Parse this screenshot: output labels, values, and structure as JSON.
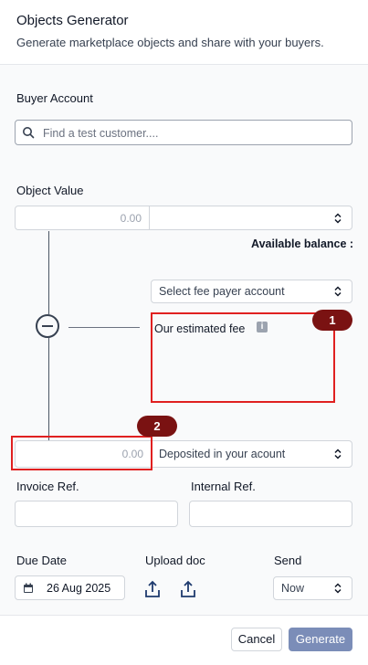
{
  "header": {
    "title": "Objects Generator",
    "subtitle": "Generate marketplace objects and share with your buyers."
  },
  "buyer_account": {
    "label": "Buyer Account",
    "search_placeholder": "Find a test customer...."
  },
  "object_value": {
    "label": "Object Value",
    "amount": "0.00",
    "currency_value": ""
  },
  "available_balance_label": "Available balance :",
  "fee_payer_select": "Select fee payer account",
  "estimated_fee_label": "Our estimated fee",
  "badges": {
    "one": "1",
    "two": "2"
  },
  "deposit": {
    "amount": "0.00",
    "select": "Deposited in your acount"
  },
  "invoice_ref_label": "Invoice Ref.",
  "internal_ref_label": "Internal Ref.",
  "due_date": {
    "label": "Due Date",
    "value": "26 Aug 2025"
  },
  "upload_doc_label": "Upload doc",
  "send": {
    "label": "Send",
    "value": "Now"
  },
  "footer": {
    "cancel": "Cancel",
    "generate": "Generate"
  },
  "colors": {
    "annotation_red": "#e02020",
    "badge_bg": "#7a1212",
    "primary_button": "#7b8db8"
  }
}
